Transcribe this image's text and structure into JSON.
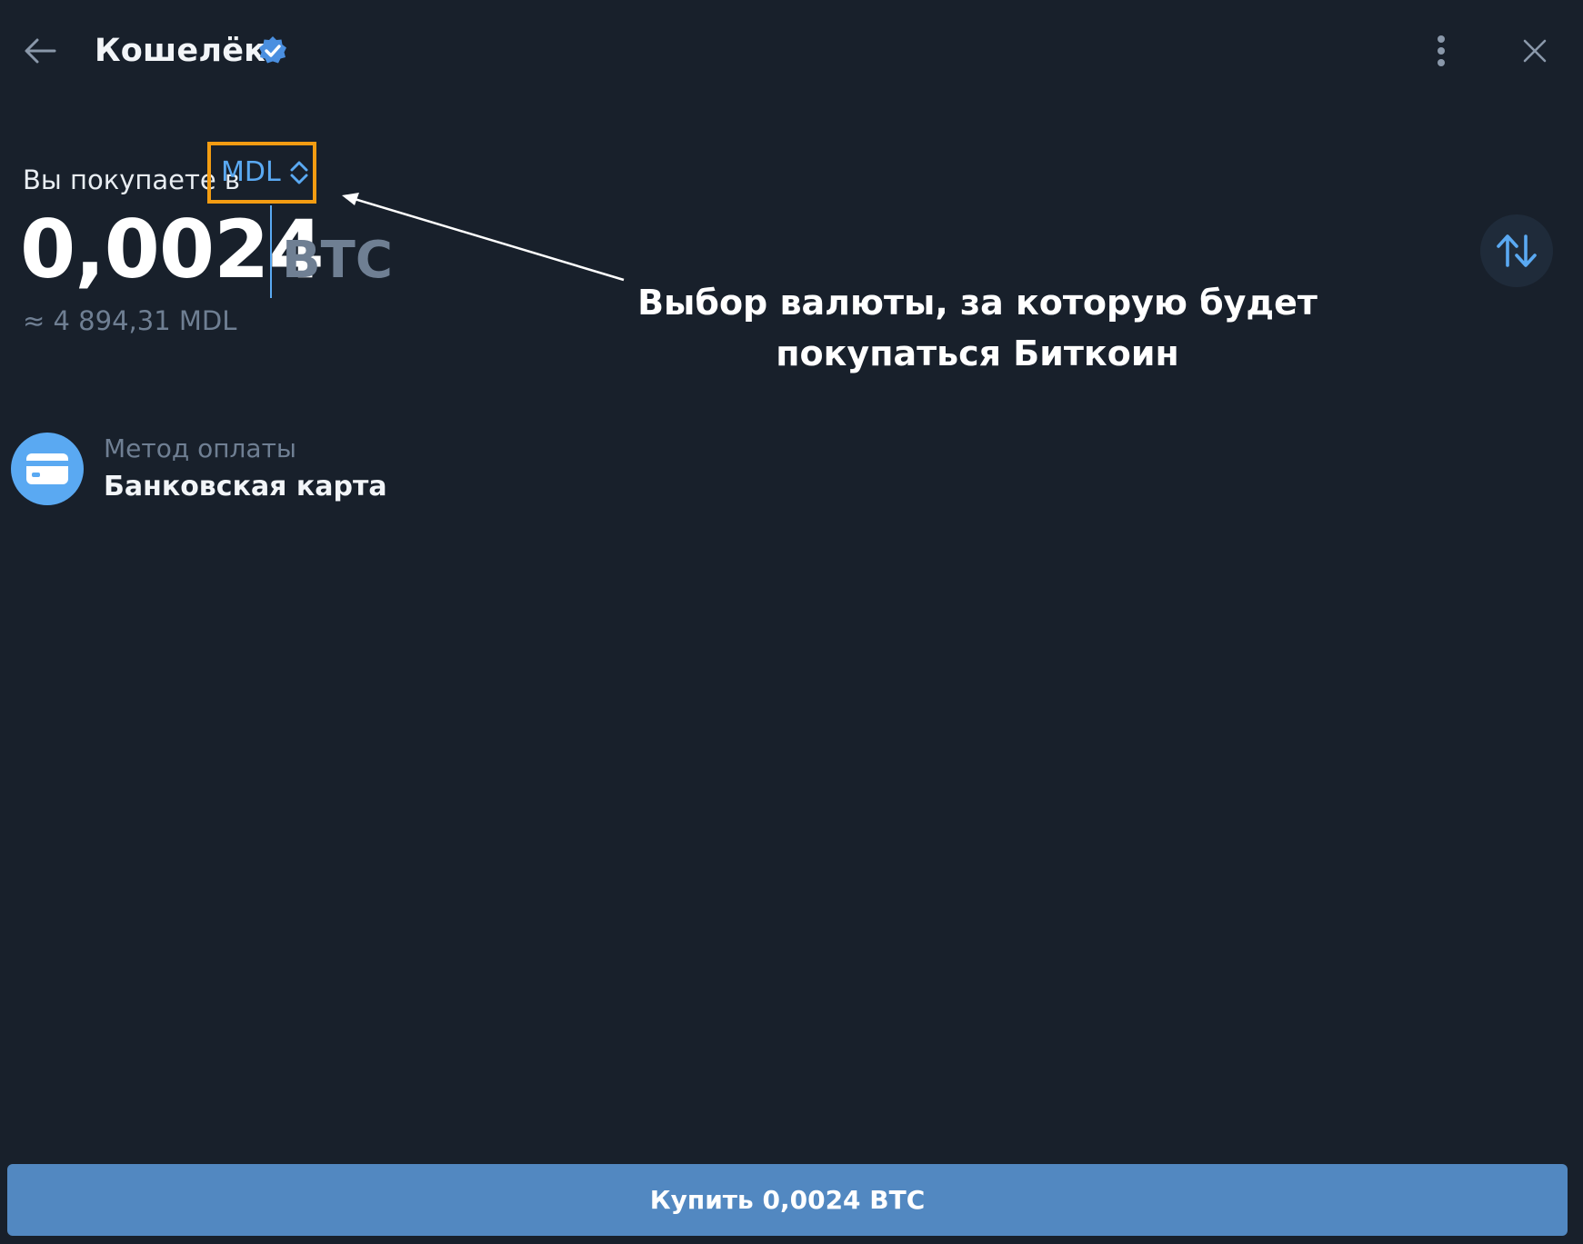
{
  "header": {
    "title": "Кошелёк",
    "verified": true
  },
  "purchase": {
    "label_prefix": "Вы покупаете в",
    "currency": "MDL",
    "amount": "0,0024",
    "asset": "BTC",
    "approx_equivalent": "≈ 4 894,31 MDL"
  },
  "payment": {
    "caption": "Метод оплаты",
    "value": "Банковская карта"
  },
  "buy_button": {
    "label": "Купить 0,0024 BTC"
  },
  "annotation": {
    "line1": "Выбор валюты, за которую будет",
    "line2": "покупаться Биткоин"
  },
  "colors": {
    "background": "#18202b",
    "accent": "#5aa9f2",
    "button": "#5288c1",
    "highlight_border": "#f39c12",
    "muted_text": "#6f7f93"
  },
  "icons": {
    "back": "arrow-left-icon",
    "verified": "verified-badge-icon",
    "more": "more-vertical-icon",
    "close": "close-icon",
    "chevrons": "chevron-up-down-icon",
    "swap": "swap-vertical-icon",
    "card": "credit-card-icon"
  }
}
